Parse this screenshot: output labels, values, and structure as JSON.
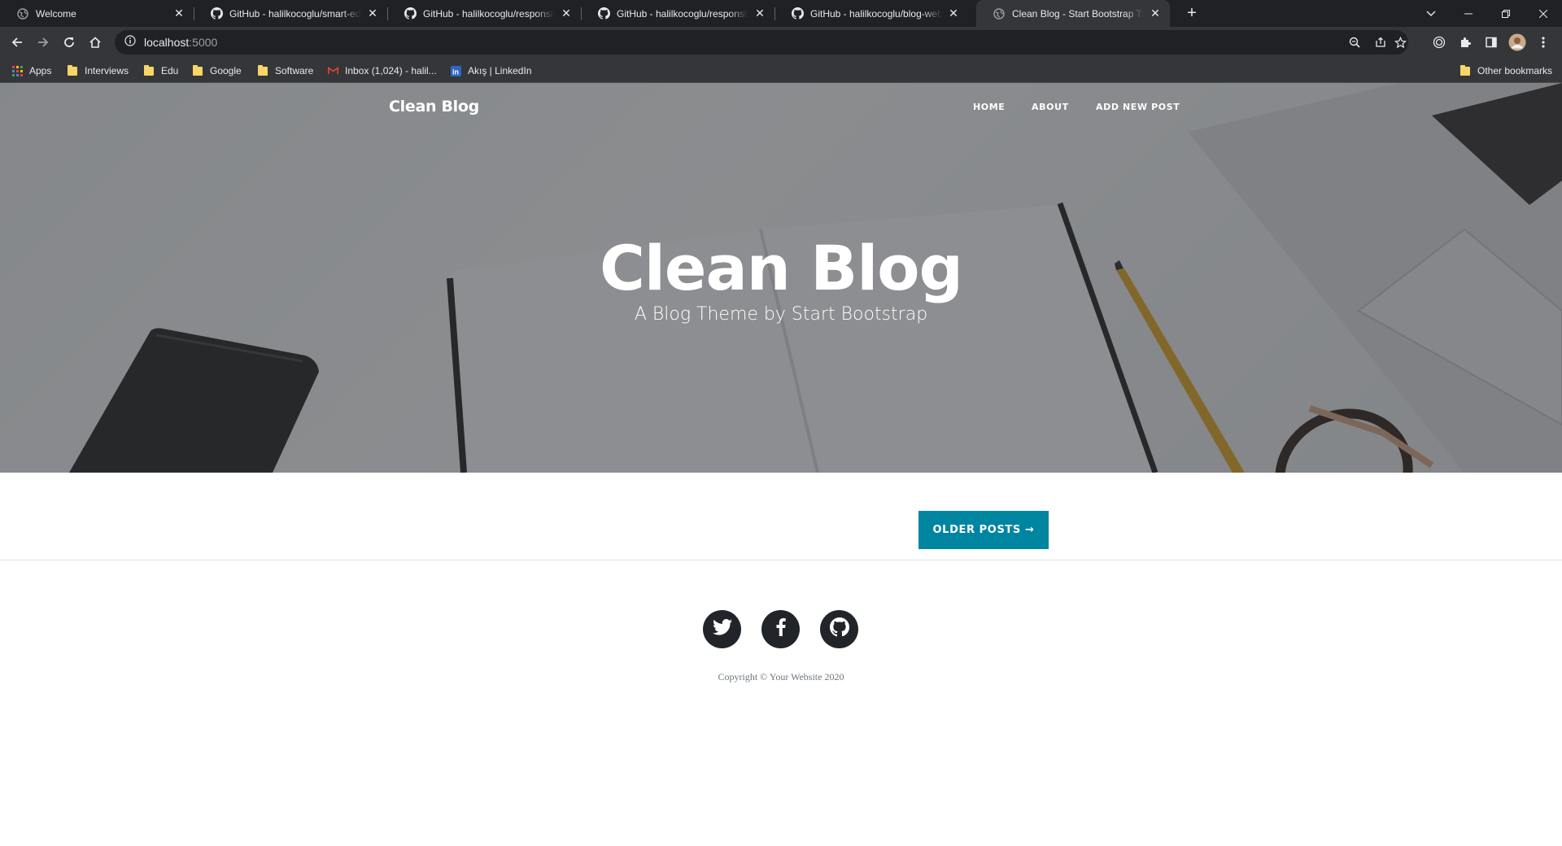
{
  "browser": {
    "tabs": [
      {
        "title": "Welcome",
        "icon": "globe-icon"
      },
      {
        "title": "GitHub - halilkocoglu/smart-edu",
        "icon": "github-icon"
      },
      {
        "title": "GitHub - halilkocoglu/responsive",
        "icon": "github-icon"
      },
      {
        "title": "GitHub - halilkocoglu/responsive",
        "icon": "github-icon"
      },
      {
        "title": "GitHub - halilkocoglu/blog-webs",
        "icon": "github-icon"
      },
      {
        "title": "Clean Blog - Start Bootstrap Theme",
        "icon": "globe-icon"
      }
    ],
    "address": {
      "host": "localhost",
      "port": ":5000"
    },
    "bookmarks": [
      {
        "label": "Apps",
        "icon": "apps-grid-icon"
      },
      {
        "label": "Interviews",
        "icon": "folder-icon"
      },
      {
        "label": "Edu",
        "icon": "folder-icon"
      },
      {
        "label": "Google",
        "icon": "folder-icon"
      },
      {
        "label": "Software",
        "icon": "folder-icon"
      },
      {
        "label": "Inbox (1,024) - halil...",
        "icon": "gmail-icon"
      },
      {
        "label": "Akış | LinkedIn",
        "icon": "linkedin-icon"
      }
    ],
    "other_bookmarks": "Other bookmarks"
  },
  "site": {
    "brand": "Clean Blog",
    "nav": [
      "HOME",
      "ABOUT",
      "ADD NEW POST"
    ],
    "heading": "Clean Blog",
    "subheading": "A Blog Theme by Start Bootstrap",
    "older_posts": "OLDER POSTS →",
    "social": [
      "twitter-icon",
      "facebook-icon",
      "github-icon"
    ],
    "copyright": "Copyright © Your Website 2020"
  },
  "colors": {
    "accent": "#0085a1",
    "footer_icon_bg": "#212529",
    "chrome_dark": "#202124",
    "chrome_toolbar": "#35363a"
  }
}
